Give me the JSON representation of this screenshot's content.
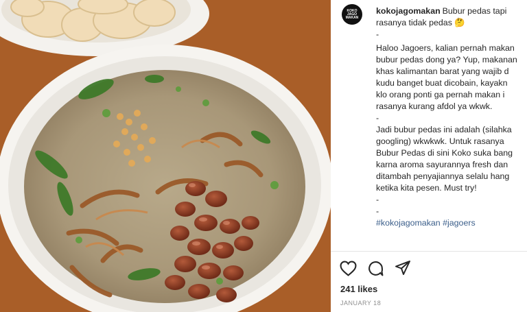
{
  "post": {
    "username": "kokojagomakan",
    "avatar_text": "KOKO JAGO MAKAN",
    "caption_lines": [
      "Bubur pedas tapi",
      "rasanya tidak pedas 🤔",
      "-",
      "Haloo Jagoers, kalian pernah makan",
      "bubur pedas dong ya? Yup, makanan",
      "khas kalimantan barat yang wajib d",
      "kudu banget buat dicobain, kayakn",
      "klo orang ponti ga pernah makan i",
      "rasanya kurang afdol ya wkwk.",
      "-",
      "Jadi bubur pedas ini adalah (silahka",
      "googling) wkwkwk. Untuk rasanya",
      "Bubur Pedas di sini Koko suka bang",
      "karna aroma sayurannya fresh dan",
      "ditambah penyajiannya selalu hang",
      "ketika kita pesen. Must try!",
      "-",
      "-",
      "#kokojagomakan #jagoers"
    ],
    "likes": "241 likes",
    "date": "JANUARY 18"
  },
  "icons": {
    "like": "heart-icon",
    "comment": "comment-icon",
    "share": "share-icon"
  },
  "colors": {
    "text": "#262626",
    "muted": "#8e8e8e",
    "hashtag": "#3b5e8a",
    "background": "#ffffff"
  }
}
